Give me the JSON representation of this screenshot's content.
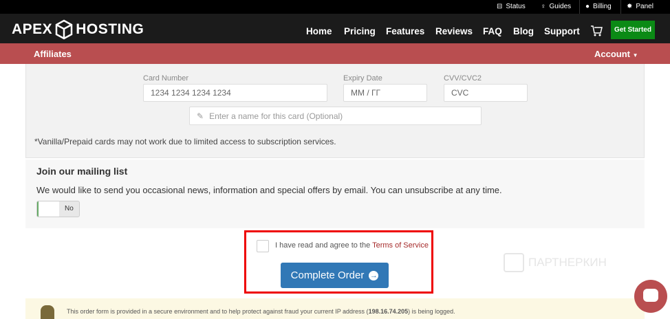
{
  "topbar": {
    "items": [
      {
        "label": "Status",
        "icon": "server-icon"
      },
      {
        "label": "Guides",
        "icon": "lightbulb-icon"
      },
      {
        "label": "Billing",
        "icon": "user-icon"
      },
      {
        "label": "Panel",
        "icon": "gear-icon"
      }
    ]
  },
  "nav": {
    "logo_left": "APEX",
    "logo_right": "HOSTING",
    "links": [
      "Home",
      "Pricing",
      "Features",
      "Reviews",
      "FAQ",
      "Blog",
      "Support"
    ],
    "cta": "Get Started"
  },
  "subnav": {
    "affiliates": "Affiliates",
    "account": "Account"
  },
  "card": {
    "number_label": "Card Number",
    "number_placeholder": "1234 1234 1234 1234",
    "expiry_label": "Expiry Date",
    "expiry_placeholder": "MM / ГГ",
    "cvv_label": "CVV/CVC2",
    "cvv_placeholder": "CVC",
    "name_placeholder": "Enter a name for this card (Optional)",
    "note": "*Vanilla/Prepaid cards may not work due to limited access to subscription services."
  },
  "mailing": {
    "title": "Join our mailing list",
    "text": "We would like to send you occasional news, information and special offers by email. You can unsubscribe at any time.",
    "toggle": "No"
  },
  "tos": {
    "text": "I have read and agree to the ",
    "link": "Terms of Service"
  },
  "order": {
    "button": "Complete Order"
  },
  "notice": {
    "text_before": "This order form is provided in a secure environment and to help protect against fraud your current IP address (",
    "ip": "198.16.74.205",
    "text_after": ") is being logged."
  },
  "watermark": "ПАРТНЕРКИН",
  "colors": {
    "brand": "#b94e50",
    "cta": "#0b8a15",
    "button": "#3178b6"
  }
}
